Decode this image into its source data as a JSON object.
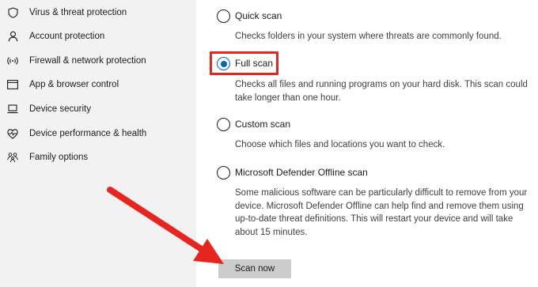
{
  "sidebar": {
    "items": [
      {
        "icon": "shield-icon",
        "label": "Virus & threat protection"
      },
      {
        "icon": "person-icon",
        "label": "Account protection"
      },
      {
        "icon": "wifi-icon",
        "label": "Firewall & network protection"
      },
      {
        "icon": "browser-window-icon",
        "label": "App & browser control"
      },
      {
        "icon": "laptop-icon",
        "label": "Device security"
      },
      {
        "icon": "heart-pulse-icon",
        "label": "Device performance & health"
      },
      {
        "icon": "family-icon",
        "label": "Family options"
      }
    ]
  },
  "scan_options": [
    {
      "label": "Quick scan",
      "description": "Checks folders in your system where threats are commonly found.",
      "selected": false
    },
    {
      "label": "Full scan",
      "description": "Checks all files and running programs on your hard disk. This scan could take longer than one hour.",
      "selected": true
    },
    {
      "label": "Custom scan",
      "description": "Choose which files and locations you want to check.",
      "selected": false
    },
    {
      "label": "Microsoft Defender Offline scan",
      "description": "Some malicious software can be particularly difficult to remove from your device. Microsoft Defender Offline can help find and remove them using up-to-date threat definitions. This will restart your device and will take about 15 minutes.",
      "selected": false
    }
  ],
  "scan_button": {
    "label": "Scan now"
  },
  "colors": {
    "accent": "#0067c0",
    "annotation": "#e8241f",
    "sidebar_bg": "#f2f2f2",
    "button_bg": "#cccccc"
  }
}
